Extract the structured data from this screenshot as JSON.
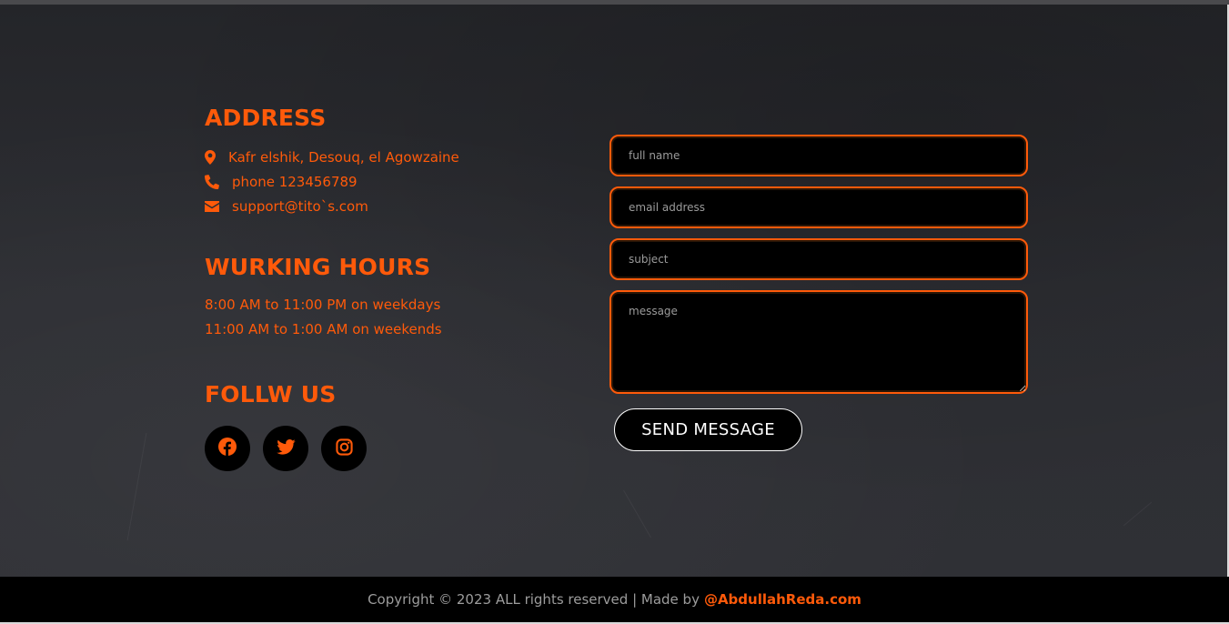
{
  "colors": {
    "accent": "#ff5a0a",
    "background": "#2a2b2f",
    "footer_bg": "#000000"
  },
  "address": {
    "title": "ADDRESS",
    "items": [
      {
        "icon": "map-marker-icon",
        "text": "Kafr elshik, Desouq, el Agowzaine"
      },
      {
        "icon": "phone-icon",
        "text": "phone 123456789"
      },
      {
        "icon": "envelope-icon",
        "text": "support@tito`s.com"
      }
    ]
  },
  "hours": {
    "title": "WURKING HOURS",
    "lines": [
      "8:00 AM to 11:00 PM on weekdays",
      "11:00 AM to 1:00 AM on weekends"
    ]
  },
  "follow": {
    "title": "FOLLW US",
    "icons": [
      "facebook-icon",
      "twitter-icon",
      "instagram-icon"
    ]
  },
  "form": {
    "name_placeholder": "full name",
    "email_placeholder": "email address",
    "subject_placeholder": "subject",
    "message_placeholder": "message",
    "send_label": "SEND MESSAGE"
  },
  "footer": {
    "text": "Copyright © 2023 ALL rights reserved | Made by",
    "link": "@AbdullahReda.com"
  }
}
